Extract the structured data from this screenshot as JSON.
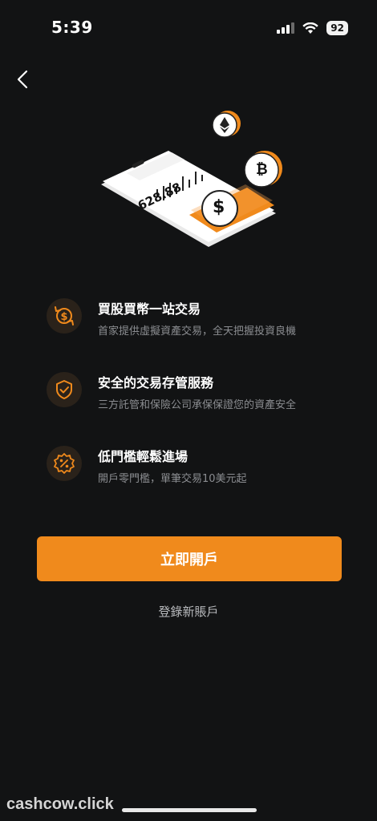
{
  "status_bar": {
    "time": "5:39",
    "battery": "92"
  },
  "hero": {
    "phone_value": "628.88",
    "coin_symbol": "$",
    "bitcoin_symbol": "₿"
  },
  "features": [
    {
      "icon": "dollar-exchange-icon",
      "title": "買股買幣一站交易",
      "desc": "首家提供虛擬資產交易，全天把握投資良機"
    },
    {
      "icon": "shield-check-icon",
      "title": "安全的交易存管服務",
      "desc": "三方託管和保險公司承保保證您的資產安全"
    },
    {
      "icon": "percent-badge-icon",
      "title": "低門檻輕鬆進場",
      "desc": "開戶零門檻，單筆交易10美元起"
    }
  ],
  "cta": {
    "label": "立即開戶"
  },
  "login": {
    "label": "登錄新賬戶"
  },
  "watermark": "cashcow.click",
  "colors": {
    "accent": "#f08a1c",
    "background": "#121314",
    "muted": "#8b8d91"
  }
}
